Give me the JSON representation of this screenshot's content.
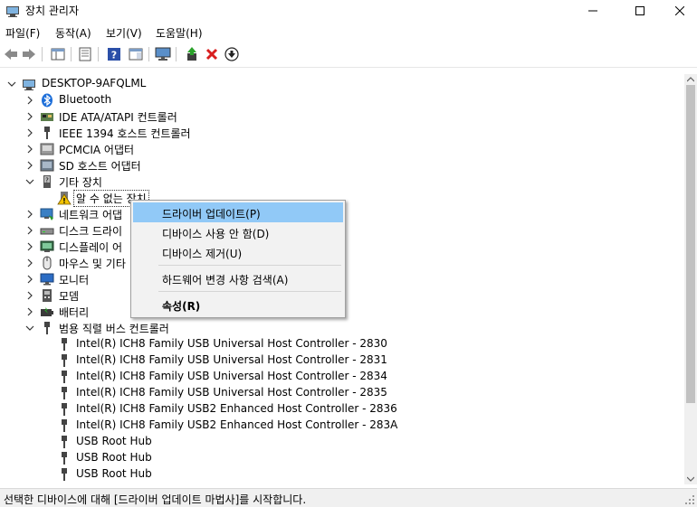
{
  "window": {
    "title": "장치 관리자",
    "minimize": "—",
    "maximize": "☐",
    "close": "✕"
  },
  "menu": {
    "items": [
      "파일(F)",
      "동작(A)",
      "보기(V)",
      "도움말(H)"
    ]
  },
  "tree": {
    "root": "DESKTOP-9AFQLML",
    "categories": [
      {
        "label": "Bluetooth",
        "icon": "bluetooth-icon",
        "expanded": false
      },
      {
        "label": "IDE ATA/ATAPI 컨트롤러",
        "icon": "ide-controller-icon",
        "expanded": false
      },
      {
        "label": "IEEE 1394 호스트 컨트롤러",
        "icon": "ieee1394-icon",
        "expanded": false
      },
      {
        "label": "PCMCIA 어댑터",
        "icon": "pcmcia-icon",
        "expanded": false
      },
      {
        "label": "SD 호스트 어댑터",
        "icon": "sd-host-icon",
        "expanded": false
      },
      {
        "label": "기타 장치",
        "icon": "other-devices-icon",
        "expanded": true
      },
      {
        "label": "네트워크 어댑",
        "icon": "network-adapter-icon",
        "expanded": false
      },
      {
        "label": "디스크 드라이",
        "icon": "disk-drive-icon",
        "expanded": false
      },
      {
        "label": "디스플레이 어",
        "icon": "display-adapter-icon",
        "expanded": false
      },
      {
        "label": "마우스 및 기타",
        "icon": "mouse-icon",
        "expanded": false
      },
      {
        "label": "모니터",
        "icon": "monitor-icon",
        "expanded": false
      },
      {
        "label": "모뎀",
        "icon": "modem-icon",
        "expanded": false
      },
      {
        "label": "배터리",
        "icon": "battery-icon",
        "expanded": false
      },
      {
        "label": "범용 직렬 버스 컨트롤러",
        "icon": "usb-controller-icon",
        "expanded": true
      }
    ],
    "unknown_device": "알 수 없는 장치",
    "usb_children": [
      "Intel(R) ICH8 Family USB Universal Host Controller - 2830",
      "Intel(R) ICH8 Family USB Universal Host Controller - 2831",
      "Intel(R) ICH8 Family USB Universal Host Controller - 2834",
      "Intel(R) ICH8 Family USB Universal Host Controller - 2835",
      "Intel(R) ICH8 Family USB2 Enhanced Host Controller - 2836",
      "Intel(R) ICH8 Family USB2 Enhanced Host Controller - 283A",
      "USB Root Hub",
      "USB Root Hub",
      "USB Root Hub"
    ]
  },
  "context_menu": {
    "update_driver": "드라이버 업데이트(P)",
    "disable_device": "디바이스 사용 안 함(D)",
    "uninstall_device": "디바이스 제거(U)",
    "scan_hardware": "하드웨어 변경 사항 검색(A)",
    "properties": "속성(R)"
  },
  "status": {
    "text": "선택한 디바이스에 대해 [드라이버 업데이트 마법사]를 시작합니다."
  },
  "colors": {
    "highlight": "#91c9f7",
    "warning": "#f2c200",
    "uninstall_red": "#d81e1e",
    "bluetooth": "#1e6fd9"
  }
}
